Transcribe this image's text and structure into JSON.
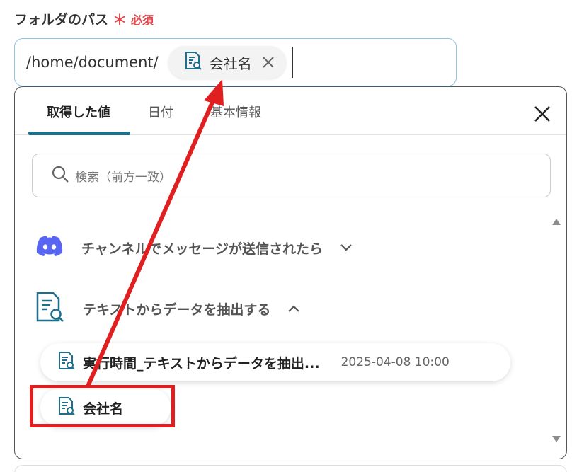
{
  "field": {
    "label": "フォルダのパス",
    "required_star": "＊",
    "required_text": "必須",
    "path_prefix": "/home/document/",
    "chip_label": "会社名"
  },
  "panel": {
    "tabs": [
      {
        "label": "取得した値",
        "active": true
      },
      {
        "label": "日付",
        "active": false
      },
      {
        "label": "基本情報",
        "active": false
      }
    ],
    "search_placeholder": "検索（前方一致）",
    "groups": [
      {
        "label": "チャンネルでメッセージが送信されたら",
        "icon": "discord-icon",
        "expanded": false
      },
      {
        "label": "テキストからデータを抽出する",
        "icon": "document-search-icon",
        "expanded": true
      }
    ],
    "items": [
      {
        "label": "実行時間_テキストからデータを抽出...",
        "time": "2025-04-08 10:00",
        "icon": "document-search-icon"
      },
      {
        "label": "会社名",
        "icon": "document-search-icon"
      }
    ]
  },
  "colors": {
    "accent": "#1f6f8b",
    "required": "#e5484d",
    "annotation": "#e02020",
    "discord": "#5865f2",
    "input_border": "#8cc8e8"
  }
}
